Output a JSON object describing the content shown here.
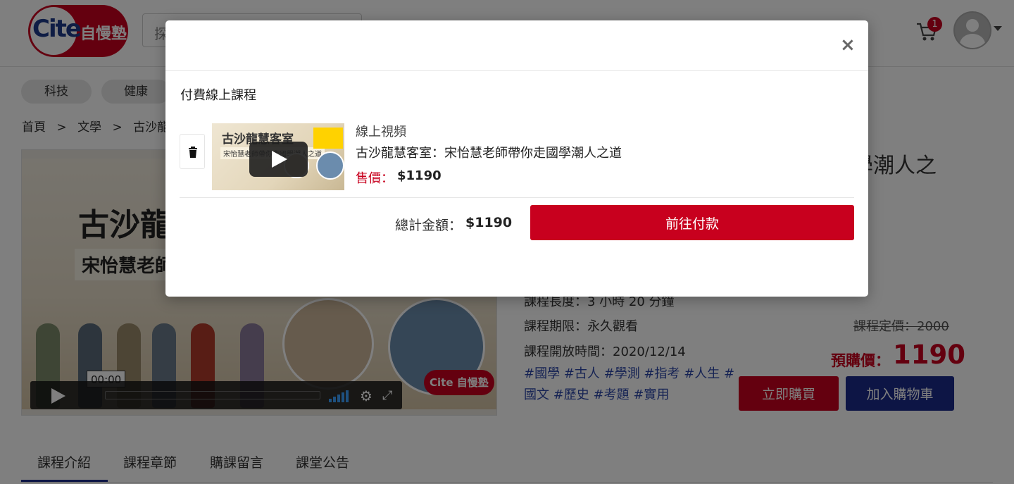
{
  "header": {
    "logo_cite": "Cite",
    "logo_text": "自慢塾",
    "search_placeholder": "探",
    "cart_count": "1"
  },
  "categories": [
    "科技",
    "健康"
  ],
  "breadcrumb": [
    "首頁",
    ">",
    "文學",
    ">",
    "古沙龍慧"
  ],
  "video": {
    "title_line1": "古沙龍",
    "title_line2": "宋怡慧老師",
    "time": "00:00",
    "mini_logo": "Cite 自慢塾"
  },
  "course": {
    "title_fragment": "學潮人之",
    "length": "課程長度：3 小時 20 分鐘",
    "period": "課程期限：永久觀看",
    "open_date": "課程開放時間：2020/12/14",
    "original_price": "課程定價：2000",
    "pre_price_label": "預購價：",
    "pre_price": "1190",
    "tags_line1": "#國學 #古人 #學測 #指考 #人生 #",
    "tags_line2": "國文 #歷史 #考題 #實用",
    "buy_label": "立即購買",
    "add_cart_label": "加入購物車"
  },
  "tabs": [
    "課程介紹",
    "課程章節",
    "購課留言",
    "課堂公告"
  ],
  "modal": {
    "close": "×",
    "section_title": "付費線上課程",
    "item": {
      "type": "線上視頻",
      "name": "古沙龍慧客室：宋怡慧老師帶你走國學潮人之道",
      "price_label": "售價：",
      "price": "$1190",
      "thumb_title": "古沙龍慧客室",
      "thumb_sub": "宋怡慧老師帶你走國學潮人之道"
    },
    "total_label": "總計金額：",
    "total_value": "$1190",
    "pay_label": "前往付款"
  }
}
